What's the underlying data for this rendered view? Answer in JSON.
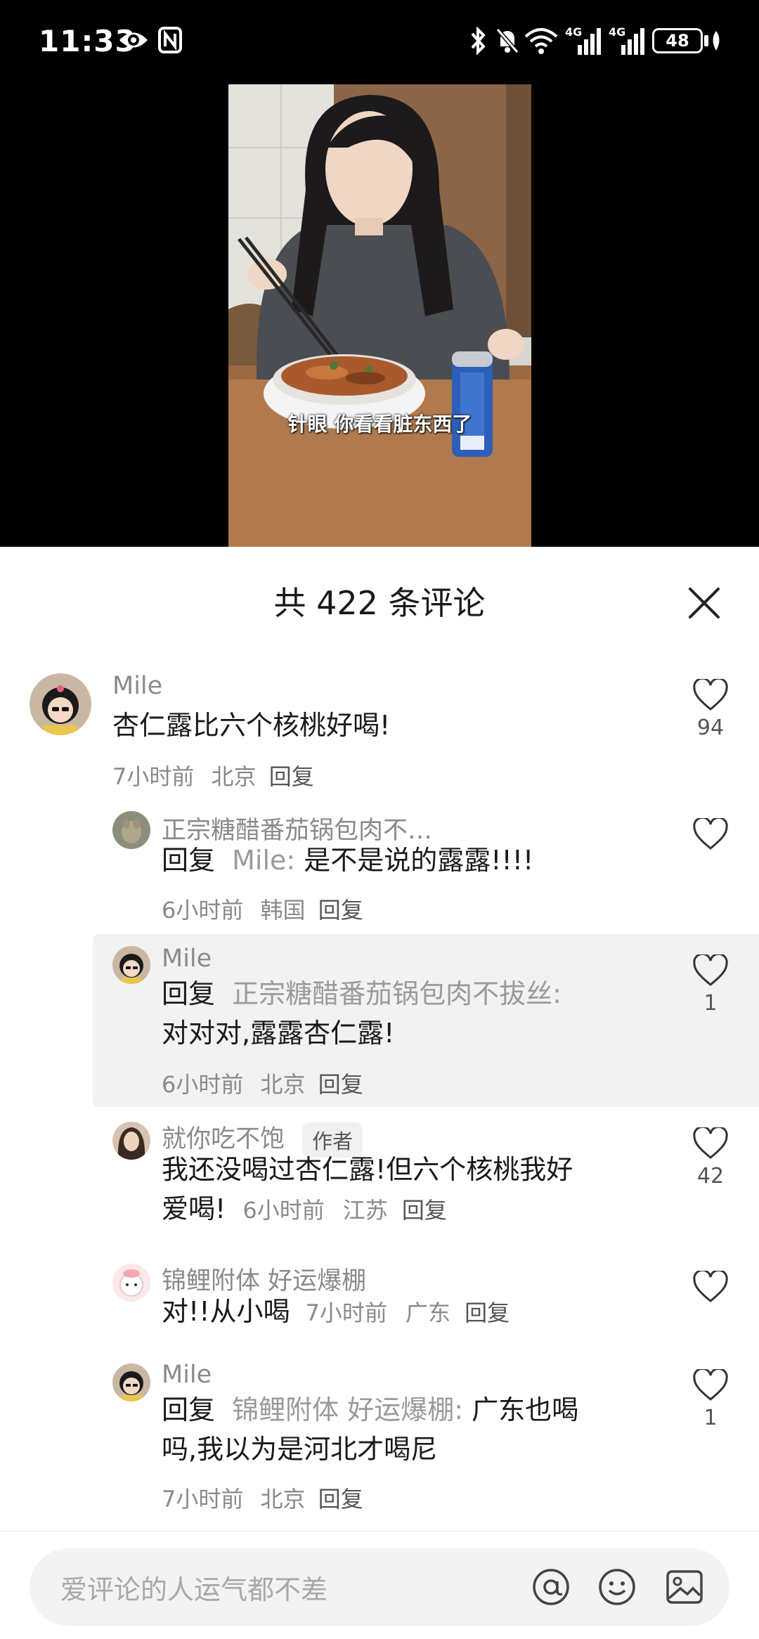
{
  "status_bar": {
    "time": "11:33",
    "battery": "48",
    "network_labels": [
      "4G",
      "4G"
    ]
  },
  "video": {
    "subtitle": "针眼 你看看脏东西了"
  },
  "comments_panel": {
    "title": "共 422 条评论",
    "comments": [
      {
        "user": "Mile",
        "text": "杏仁露比六个核桃好喝!",
        "time": "7小时前",
        "location": "北京",
        "reply_label": "回复",
        "likes": "94"
      },
      {
        "user": "正宗糖醋番茄锅包肉不…",
        "reply_prefix": "回复",
        "reply_to": "Mile",
        "text": "是不是说的露露!!!!",
        "time": "6小时前",
        "location": "韩国",
        "reply_label": "回复",
        "likes": ""
      },
      {
        "user": "Mile",
        "reply_prefix": "回复",
        "reply_to": "正宗糖醋番茄锅包肉不拔丝",
        "text": "对对对,露露杏仁露!",
        "time": "6小时前",
        "location": "北京",
        "reply_label": "回复",
        "likes": "1"
      },
      {
        "user": "就你吃不饱",
        "badge": "作者",
        "text_line1": "我还没喝过杏仁露!但六个核桃我好",
        "text_line2": "爱喝!",
        "time": "6小时前",
        "location": "江苏",
        "reply_label": "回复",
        "likes": "42"
      },
      {
        "user": "锦鲤附体 好运爆棚",
        "text": "对!!从小喝",
        "time": "7小时前",
        "location": "广东",
        "reply_label": "回复",
        "likes": ""
      },
      {
        "user": "Mile",
        "reply_prefix": "回复",
        "reply_to": "锦鲤附体 好运爆棚",
        "text_line1": "广东也喝",
        "text_line2": "吗,我以为是河北才喝尼",
        "time": "7小时前",
        "location": "北京",
        "reply_label": "回复",
        "likes": "1"
      }
    ]
  },
  "input": {
    "placeholder": "爱评论的人运气都不差"
  },
  "colors": {
    "background": "#ffffff",
    "text": "#1a1a1a",
    "muted": "#8a8a8a",
    "highlight": "#f2f2f2",
    "statusbar": "#000000"
  }
}
